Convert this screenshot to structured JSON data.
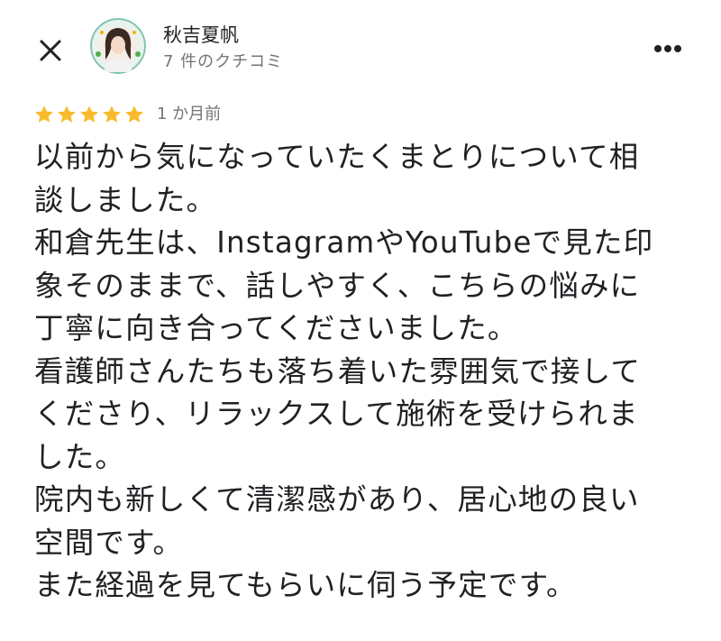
{
  "header": {
    "reviewer_name": "秋吉夏帆",
    "review_count": "7 件のクチコミ"
  },
  "rating": {
    "stars": 5,
    "max_stars": 5,
    "date": "1 か月前",
    "star_color": "#f9bb2b"
  },
  "review": {
    "lines": [
      "以前から気になっていたくまとりについて相",
      "談しました。",
      "和倉先生は、InstagramやYouTubeで見た印",
      "象そのままで、話しやすく、こちらの悩みに",
      "丁寧に向き合ってくださいました。",
      "看護師さんたちも落ち着いた雰囲気で接して",
      "くださり、リラックスして施術を受けられま",
      "した。",
      "院内も新しくて清潔感があり、居心地の良い",
      "空間です。",
      "また経過を見てもらいに伺う予定です。"
    ]
  },
  "icons": {
    "close": "close-icon",
    "more": "more-vert-icon",
    "avatar": "avatar-image",
    "star": "star-icon"
  }
}
